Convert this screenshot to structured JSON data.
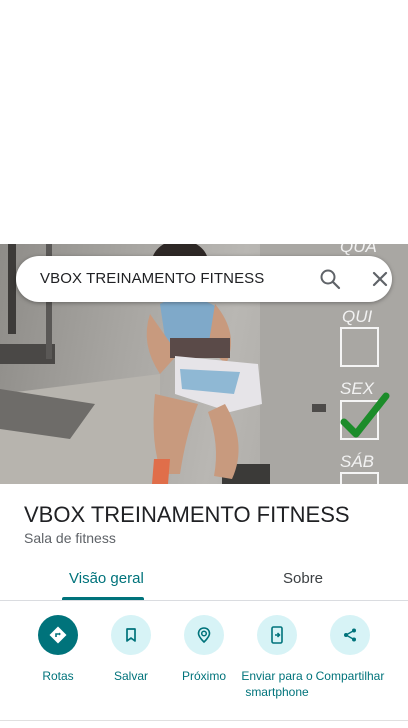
{
  "search": {
    "query": "VBOX TREINAMENTO FITNESS"
  },
  "hero": {
    "days": [
      "QUA",
      "QUI",
      "SEX",
      "SÁB"
    ]
  },
  "place": {
    "title": "VBOX TREINAMENTO FITNESS",
    "category": "Sala de fitness"
  },
  "tabs": [
    {
      "label": "Visão geral",
      "active": true
    },
    {
      "label": "Sobre",
      "active": false
    }
  ],
  "actions": [
    {
      "label": "Rotas",
      "icon": "directions-icon"
    },
    {
      "label": "Salvar",
      "icon": "bookmark-icon"
    },
    {
      "label": "Próximo",
      "icon": "nearby-icon"
    },
    {
      "label": "Enviar para o smartphone",
      "icon": "send-to-phone-icon"
    },
    {
      "label": "Compartilhar",
      "icon": "share-icon"
    }
  ],
  "colors": {
    "accent": "#00737b",
    "accent_light": "#d7f3f6",
    "text": "#202124",
    "secondary": "#5f6368"
  }
}
